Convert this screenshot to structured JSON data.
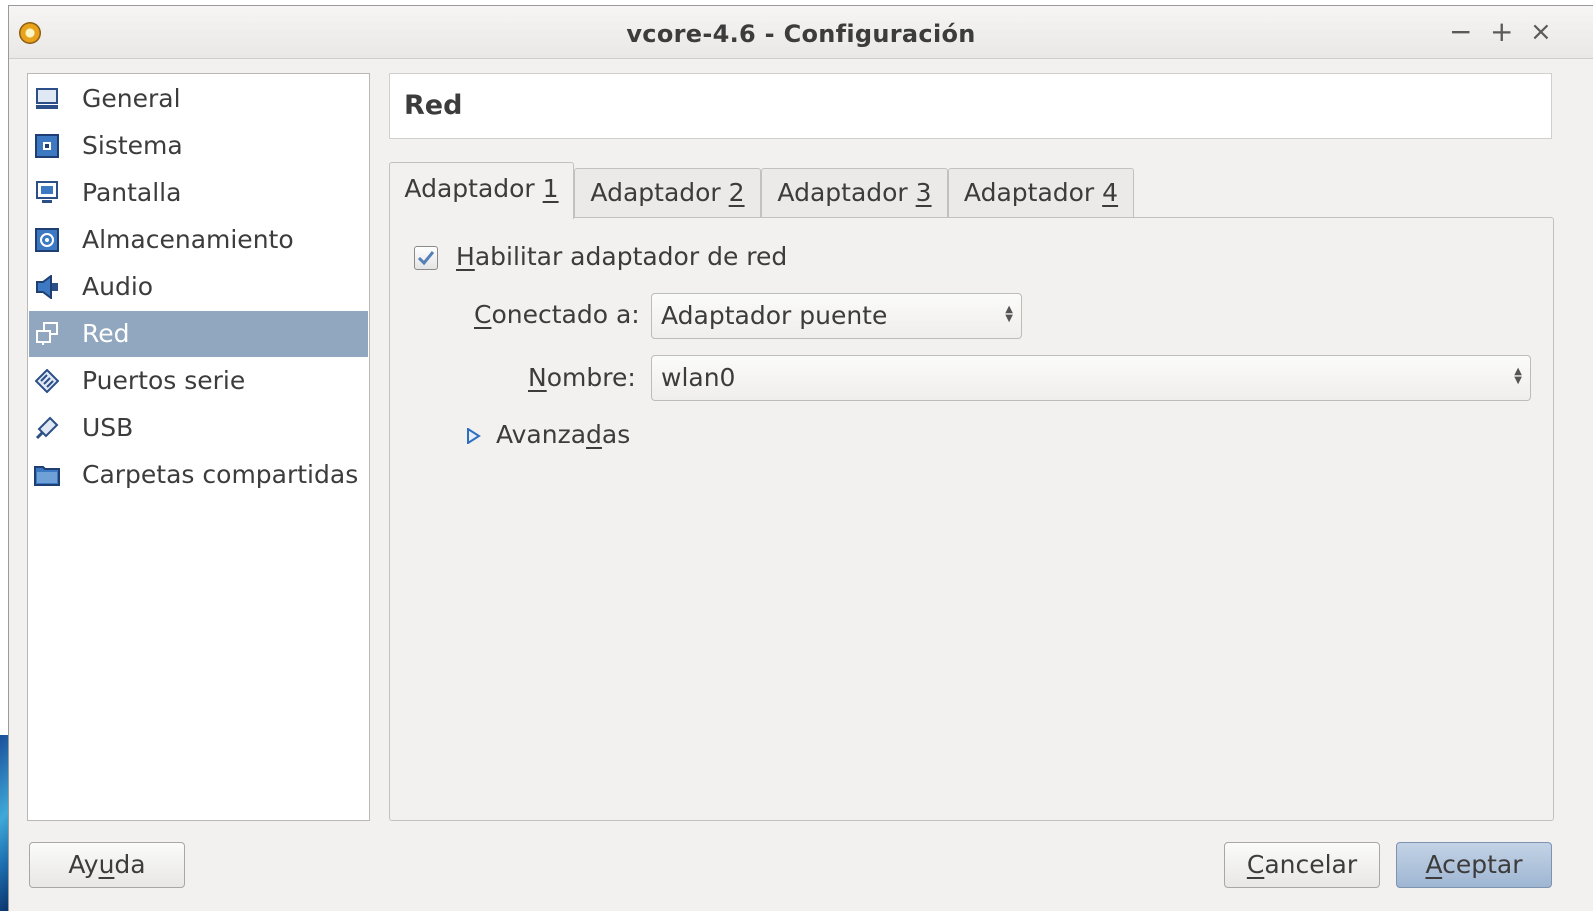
{
  "window": {
    "title": "vcore-4.6 - Configuración",
    "controls": {
      "minimize": "−",
      "maximize": "+",
      "close": "×"
    }
  },
  "sidebar": {
    "items": [
      {
        "label": "General",
        "icon": "monitor-icon"
      },
      {
        "label": "Sistema",
        "icon": "chip-icon"
      },
      {
        "label": "Pantalla",
        "icon": "display-icon"
      },
      {
        "label": "Almacenamiento",
        "icon": "storage-icon"
      },
      {
        "label": "Audio",
        "icon": "speaker-icon"
      },
      {
        "label": "Red",
        "icon": "network-icon",
        "selected": true
      },
      {
        "label": "Puertos serie",
        "icon": "serial-port-icon"
      },
      {
        "label": "USB",
        "icon": "usb-icon"
      },
      {
        "label": "Carpetas compartidas",
        "icon": "folder-icon"
      }
    ]
  },
  "header": {
    "title": "Red"
  },
  "tabs": [
    {
      "text": "Adaptador ",
      "key": "1",
      "active": true
    },
    {
      "text": "Adaptador ",
      "key": "2"
    },
    {
      "text": "Adaptador ",
      "key": "3"
    },
    {
      "text": "Adaptador ",
      "key": "4"
    }
  ],
  "adapter": {
    "enable": {
      "key": "H",
      "rest": "abilitar adaptador de red",
      "checked": true
    },
    "connected": {
      "key": "C",
      "rest": "onectado a:",
      "value": "Adaptador puente"
    },
    "name": {
      "key": "N",
      "rest": "ombre:",
      "value": "wlan0"
    },
    "advanced": {
      "pre": "Avanza",
      "key": "d",
      "post": "as",
      "expanded": false
    }
  },
  "buttons": {
    "help": {
      "pre": "Ay",
      "key": "u",
      "post": "da"
    },
    "cancel": {
      "pre": "",
      "key": "C",
      "post": "ancelar"
    },
    "accept": {
      "pre": "",
      "key": "A",
      "post": "ceptar"
    }
  },
  "colors": {
    "selection": "#91a7bf",
    "accent": "#1d6fb0",
    "default_button": "#a9bdd6"
  }
}
